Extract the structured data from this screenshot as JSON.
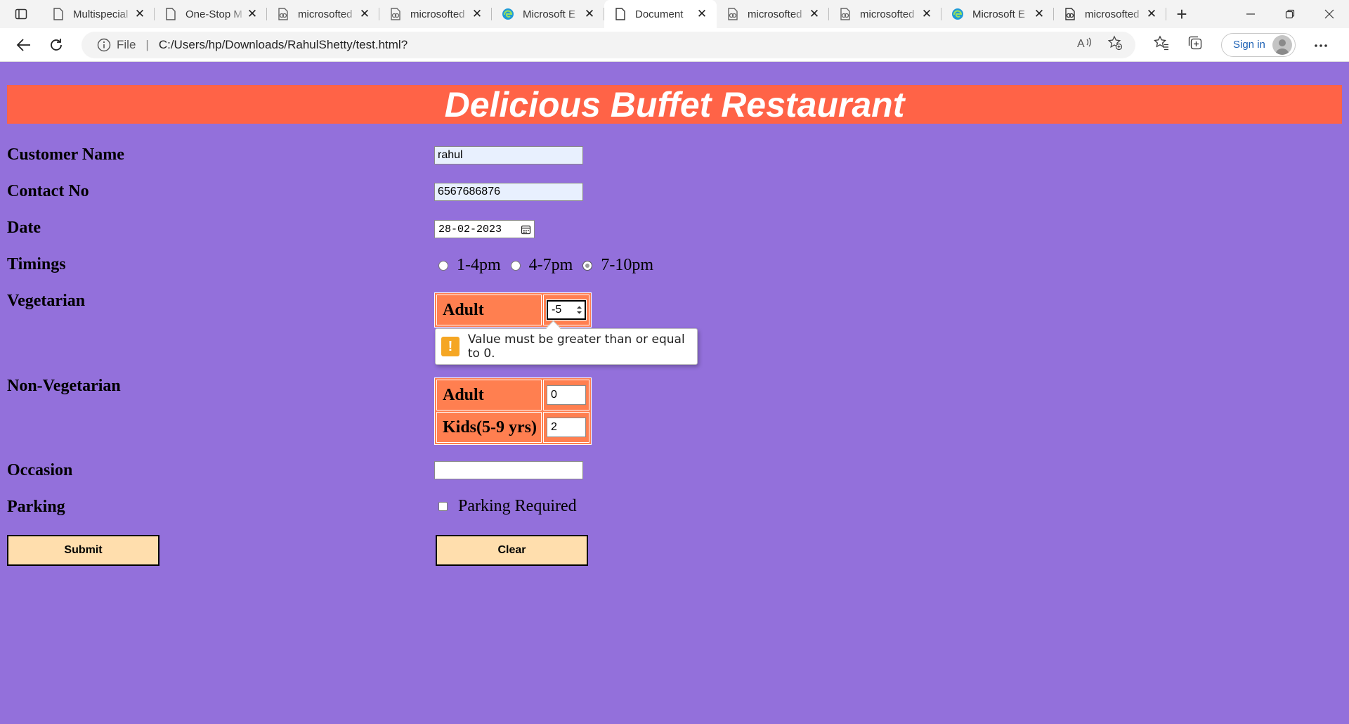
{
  "browser": {
    "tabs": [
      {
        "label": "Multispecial",
        "icon": "page-icon"
      },
      {
        "label": "One-Stop M",
        "icon": "page-icon"
      },
      {
        "label": "microsofted",
        "icon": "link-page-icon"
      },
      {
        "label": "microsofted",
        "icon": "link-page-icon"
      },
      {
        "label": "Microsoft E",
        "icon": "edge-icon"
      },
      {
        "label": "Document",
        "icon": "page-icon",
        "active": true
      },
      {
        "label": "microsofted",
        "icon": "link-page-icon"
      },
      {
        "label": "microsofted",
        "icon": "link-page-icon"
      },
      {
        "label": "Microsoft E",
        "icon": "edge-icon"
      },
      {
        "label": "microsofted",
        "icon": "link-page-icon"
      }
    ],
    "address": {
      "scheme_label": "File",
      "url": "C:/Users/hp/Downloads/RahulShetty/test.html?"
    },
    "signin_label": "Sign in"
  },
  "page": {
    "title": "Delicious Buffet Restaurant",
    "labels": {
      "customer_name": "Customer Name",
      "contact_no": "Contact No",
      "date": "Date",
      "timings": "Timings",
      "vegetarian": "Vegetarian",
      "non_vegetarian": "Non-Vegetarian",
      "occasion": "Occasion",
      "parking": "Parking"
    },
    "values": {
      "customer_name": "rahul",
      "contact_no": "6567686876",
      "date": "28-02-2023",
      "occasion": ""
    },
    "timings": {
      "options": [
        "1-4pm",
        "4-7pm",
        "7-10pm"
      ],
      "selected": "7-10pm"
    },
    "vegetarian": {
      "adult_label": "Adult",
      "adult_value": "-5"
    },
    "non_vegetarian": {
      "adult_label": "Adult",
      "adult_value": "0",
      "kids_label": "Kids(5-9 yrs)",
      "kids_value": "2"
    },
    "validation_message": "Value must be greater than or equal to 0.",
    "parking": {
      "checkbox_label": "Parking Required",
      "checked": false
    },
    "buttons": {
      "submit": "Submit",
      "clear": "Clear"
    }
  },
  "colors": {
    "page_background": "#9370db",
    "banner": "#ff6347",
    "table_cells": "#ff7f50",
    "buttons": "#ffdead",
    "warning": "#f5a623"
  }
}
